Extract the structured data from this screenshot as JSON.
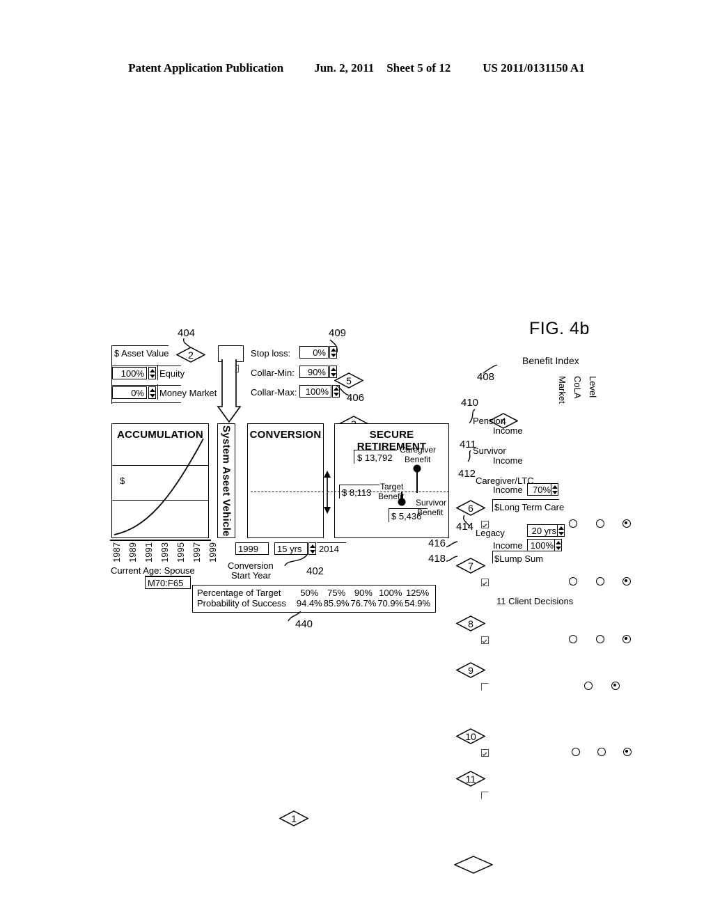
{
  "header": {
    "publication": "Patent Application Publication",
    "date": "Jun. 2, 2011",
    "sheet": "Sheet 5 of 12",
    "number": "US 2011/0131150 A1"
  },
  "figure": {
    "label": "FIG. 4b"
  },
  "asset_panel": {
    "title": "$ Asset Value",
    "diamond": "2",
    "ref": "404",
    "checkbox_checked": true,
    "rows": [
      {
        "value": "100%",
        "label": "Equity"
      },
      {
        "value": "0%",
        "label": "Money Market"
      }
    ]
  },
  "risk_panel": {
    "rows": [
      {
        "label": "Stop loss:",
        "value": "0%"
      },
      {
        "label": "Collar-Min:",
        "value": "90%"
      },
      {
        "label": "Collar-Max:",
        "value": "100%"
      }
    ],
    "diamond_stoploss": "5",
    "ref_stoploss": "409",
    "diamond_collar": "3",
    "ref_collar": "406"
  },
  "benefit_index": {
    "title": "Benefit Index",
    "diamond": "4",
    "ref": "408",
    "columns": [
      "Market",
      "CoLA",
      "Level"
    ]
  },
  "benefit_groups": [
    {
      "ref": "410",
      "group_label": "Pension",
      "rows": [
        {
          "diamond": "6",
          "checked": true,
          "label": "Income",
          "radios": [
            false,
            false,
            true
          ],
          "radio_count": 3
        }
      ]
    },
    {
      "ref": "411",
      "group_label": "Survivor",
      "rows": [
        {
          "diamond": "7",
          "checked": true,
          "label": "Income",
          "radios": [
            false,
            false,
            true
          ],
          "radio_count": 3
        }
      ]
    },
    {
      "ref": "412",
      "group_label": "Caregiver/LTC",
      "rows": [
        {
          "diamond": "8",
          "checked": true,
          "label": "Income",
          "value": "70%",
          "radios": [
            false,
            false,
            true
          ],
          "radio_count": 3
        },
        {
          "diamond": "9",
          "checked": false,
          "label": "$Long Term Care",
          "radios": [
            false,
            true
          ],
          "radio_count": 2
        }
      ]
    },
    {
      "ref": "414",
      "group_label": "Legacy",
      "term_value": "20 yrs",
      "rows": [
        {
          "diamond": "10",
          "ref": "416",
          "checked": true,
          "label": "Income",
          "value": "100%",
          "radios": [
            false,
            false,
            true
          ],
          "radio_count": 3
        },
        {
          "diamond": "11",
          "ref": "418",
          "checked": false,
          "label": "$Lump Sum",
          "radios": [],
          "radio_count": 0
        }
      ]
    }
  ],
  "stages": {
    "accumulation": {
      "title": "ACCUMULATION",
      "axis_symbol": "$"
    },
    "vehicle": {
      "title": "System Aseet Vehicle"
    },
    "conversion": {
      "title": "CONVERSION"
    },
    "secure": {
      "title": "SECURE RETIREMENT",
      "caregiver_value": "$ 13,792",
      "caregiver_label": "Caregiver\nBenefit",
      "caregiver_label_1": "Caregiver",
      "caregiver_label_2": "Benefit",
      "target_value": "$ 8,113",
      "target_label_1": "Target",
      "target_label_2": "Benefit",
      "survivor_value": "$ 5,436",
      "survivor_label_1": "Survivor",
      "survivor_label_2": "Benefit"
    }
  },
  "timeline": {
    "years": [
      "1987",
      "1989",
      "1991",
      "1993",
      "1995",
      "1997",
      "1999"
    ],
    "current_age_label": "Current Age: Spouse",
    "current_age_value": "M70:F65",
    "start_year": "1999",
    "duration": "15 yrs",
    "end_year": "2014",
    "conversion_label_1": "Conversion",
    "conversion_label_2": "Start Year",
    "diamond": "1",
    "ref": "402"
  },
  "probability": {
    "ref": "440",
    "row_labels": [
      "Percentage of Target",
      "Probability of Success"
    ],
    "percentage_of_target": [
      "50%",
      "75%",
      "90%",
      "100%",
      "125%"
    ],
    "probability_of_success": [
      "94.4%",
      "85.9%",
      "76.7%",
      "70.9%",
      "54.9%"
    ]
  },
  "legend": {
    "text": "11 Client Decisions"
  }
}
